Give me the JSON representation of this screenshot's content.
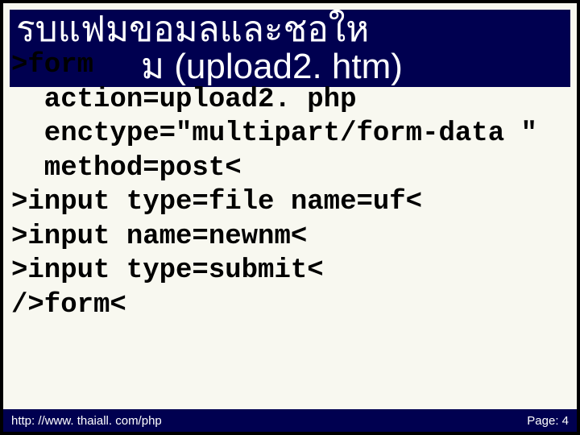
{
  "title": {
    "line1": "รบแฟมขอมลและชอให",
    "line2": "ม  (upload2. htm)"
  },
  "code": {
    "l1": ">form",
    "l2": "  action=upload2. php",
    "l3": "  enctype=\"multipart/form-data \"",
    "l4": "  method=post<",
    "l5": ">input type=file name=uf<",
    "l6": ">input name=newnm<",
    "l7": ">input type=submit<",
    "l8": "/>form<"
  },
  "footer": {
    "url": "http: //www. thaiall. com/php",
    "page": "Page: 4"
  }
}
